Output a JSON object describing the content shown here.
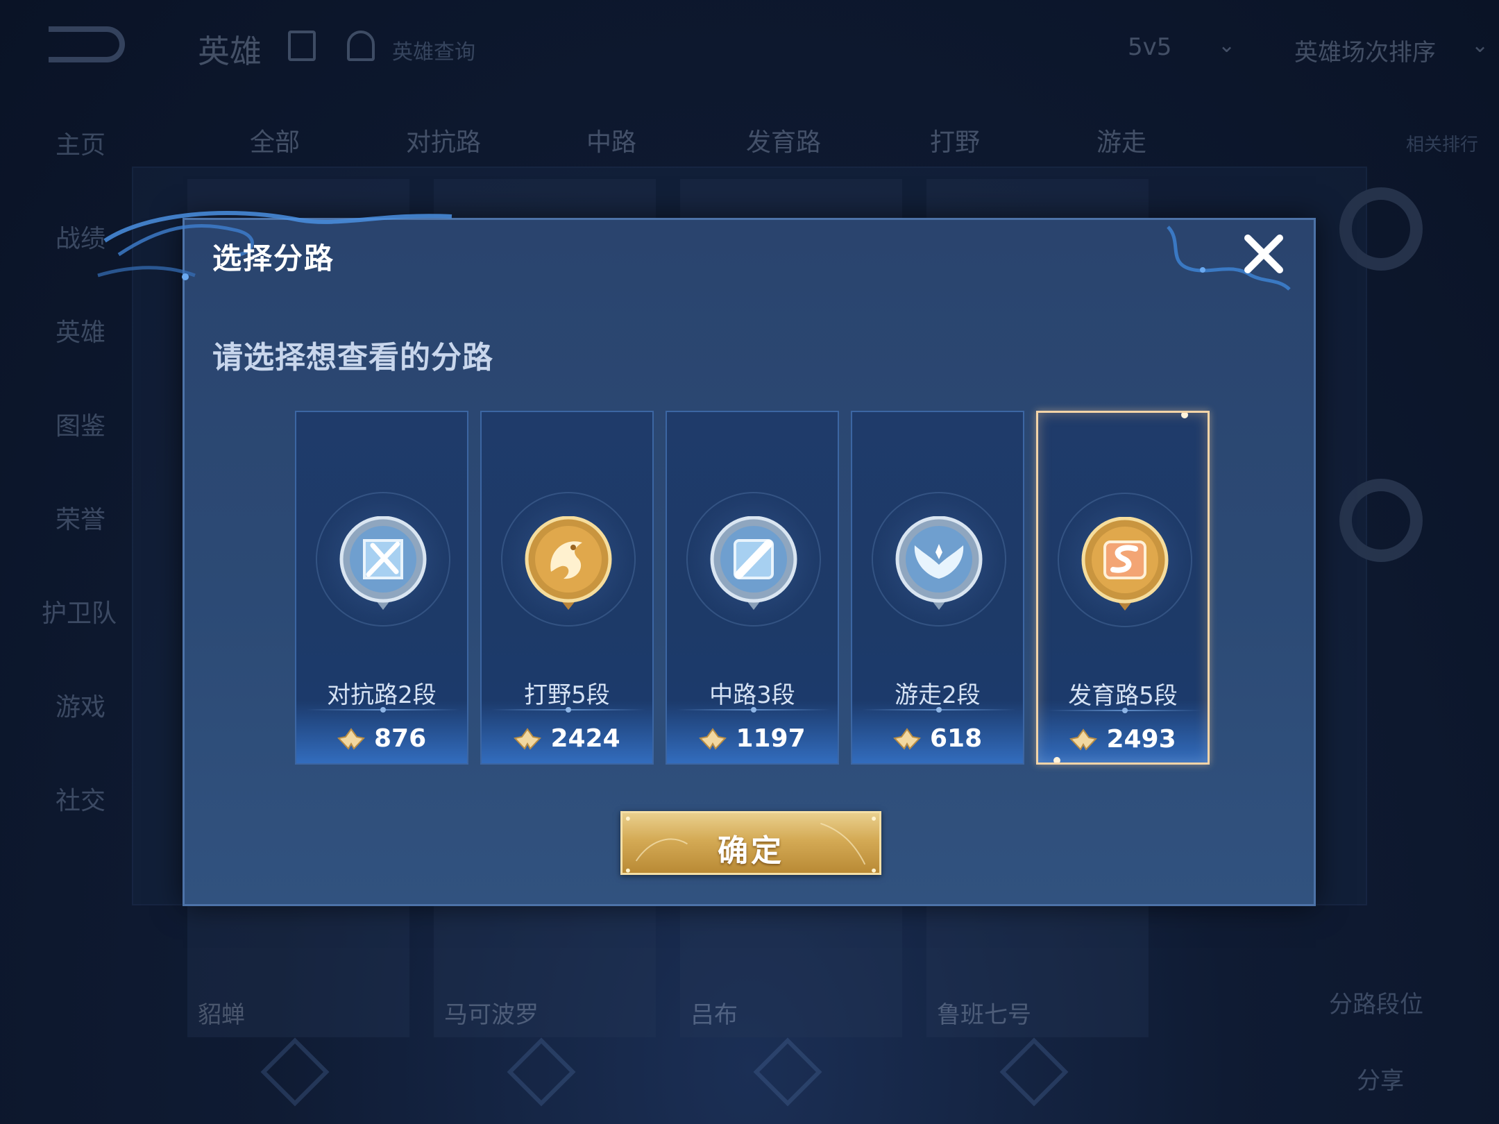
{
  "background": {
    "app_title": "英雄",
    "search_hint": "英雄查询",
    "mode_select": "5v5",
    "sort_select": "英雄场次排序",
    "side_nav": [
      "主页",
      "战绩",
      "英雄",
      "图鉴",
      "荣誉",
      "护卫队",
      "游戏",
      "社交"
    ],
    "tabs": [
      "全部",
      "对抗路",
      "中路",
      "发育路",
      "打野",
      "游走"
    ],
    "tab_right": "相关排行",
    "hero_names": [
      "貂蝉",
      "马可波罗",
      "吕布",
      "鲁班七号"
    ],
    "right_labels": [
      "分路段位",
      "分享"
    ]
  },
  "modal": {
    "title": "选择分路",
    "prompt": "请选择想查看的分路",
    "confirm_label": "确定",
    "lanes": [
      {
        "label": "对抗路2段",
        "score": "876",
        "badge": "silver-sword-icon",
        "selected": false
      },
      {
        "label": "打野5段",
        "score": "2424",
        "badge": "gold-dragon-icon",
        "selected": false
      },
      {
        "label": "中路3段",
        "score": "1197",
        "badge": "silver-staff-icon",
        "selected": false
      },
      {
        "label": "游走2段",
        "score": "618",
        "badge": "silver-wings-icon",
        "selected": false
      },
      {
        "label": "发育路5段",
        "score": "2493",
        "badge": "gold-archer-icon",
        "selected": true
      }
    ]
  },
  "colors": {
    "gold": "#d4aa55",
    "silver": "#a9c3de",
    "selected_border": "#f3d4a8",
    "modal_bg": "#2c4a75"
  }
}
